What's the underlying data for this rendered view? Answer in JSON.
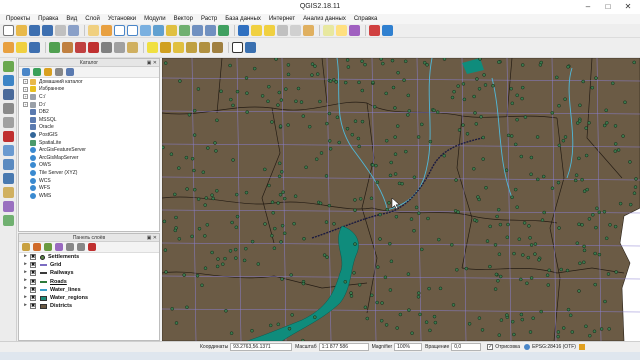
{
  "window": {
    "title": "QGIS2.18.11"
  },
  "menu": [
    "Проекты",
    "Правка",
    "Вид",
    "Слой",
    "Установки",
    "Модули",
    "Вектор",
    "Растр",
    "База данных",
    "Интернет",
    "Анализ данных",
    "Справка"
  ],
  "catalog_panel": {
    "title": "Каталог",
    "items": [
      {
        "label": "Домашний каталог",
        "icon": "home-folder-icon",
        "expandable": true
      },
      {
        "label": "Избранное",
        "icon": "star-icon",
        "expandable": true
      },
      {
        "label": "C:/",
        "icon": "drive-icon",
        "expandable": true
      },
      {
        "label": "D:/",
        "icon": "drive-icon",
        "expandable": true
      },
      {
        "label": "DB2",
        "icon": "database-icon",
        "expandable": false
      },
      {
        "label": "MSSQL",
        "icon": "database-icon",
        "expandable": false
      },
      {
        "label": "Oracle",
        "icon": "database-icon",
        "expandable": false
      },
      {
        "label": "PostGIS",
        "icon": "elephant-icon",
        "expandable": false
      },
      {
        "label": "SpatiaLite",
        "icon": "feather-icon",
        "expandable": false
      },
      {
        "label": "ArcGisFeatureServer",
        "icon": "globe-icon",
        "expandable": false
      },
      {
        "label": "ArcGisMapServer",
        "icon": "globe-icon",
        "expandable": false
      },
      {
        "label": "OWS",
        "icon": "globe-icon",
        "expandable": false
      },
      {
        "label": "Tile Server (XYZ)",
        "icon": "globe-icon",
        "expandable": false
      },
      {
        "label": "WCS",
        "icon": "globe-icon",
        "expandable": false
      },
      {
        "label": "WFS",
        "icon": "globe-icon",
        "expandable": false
      },
      {
        "label": "WMS",
        "icon": "globe-icon",
        "expandable": false
      }
    ]
  },
  "layers_panel": {
    "title": "Панель слоёв",
    "layers": [
      {
        "name": "Settlements",
        "checked": true,
        "symbol": "point",
        "color": "#5f8a4a"
      },
      {
        "name": "Grid",
        "checked": true,
        "symbol": "line",
        "color": "#7b6cc2"
      },
      {
        "name": "Railways",
        "checked": true,
        "symbol": "line",
        "color": "#3a3a3a"
      },
      {
        "name": "Roads",
        "checked": true,
        "symbol": "line",
        "color": "#2c7a3a"
      },
      {
        "name": "Water_lines",
        "checked": true,
        "symbol": "line",
        "color": "#3aa0c8"
      },
      {
        "name": "Water_regions",
        "checked": true,
        "symbol": "fill",
        "color": "#1a8c7a"
      },
      {
        "name": "Districts",
        "checked": true,
        "symbol": "fill",
        "color": "#6b5a45"
      }
    ]
  },
  "map": {
    "background_color": "#ffffff",
    "district_fill": "#6b5b45",
    "settlement_color": "#3d7a4e",
    "grid_color": "#8a7fd0",
    "water_color": "#0f8c7c",
    "railway_color": "#1a1a40",
    "water_line_color": "#50b8d8"
  },
  "status": {
    "coord_label": "Координаты",
    "coord_value": "93.2763,56.1371",
    "scale_label": "Масштаб",
    "scale_value": "1:1 877 586",
    "magnifier_label": "Magnifier",
    "magnifier_value": "100%",
    "rotation_label": "Вращение",
    "rotation_value": "0,0",
    "render_label": "Отрисовка",
    "crs_label": "EPSG:28416 (OTF)"
  }
}
